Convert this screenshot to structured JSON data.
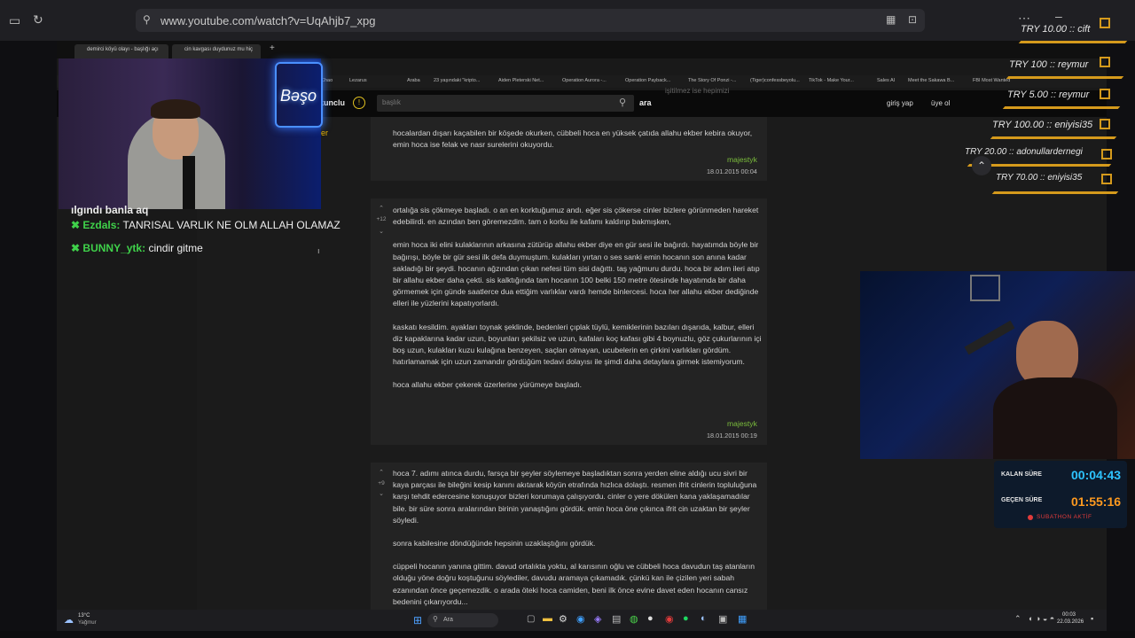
{
  "browser": {
    "url": "www.youtube.com/watch?v=UqAhjb7_xpg"
  },
  "inner_browser": {
    "tabs": [
      "demirci köyü olayı - başlığı açı",
      "cin kavgası duydunuz mu hiç"
    ],
    "bookmarks": [
      "Chao",
      "Lezarus",
      "Araba",
      "23 yaşındaki \"kripto...",
      "Aiden Pleterski Net...",
      "Operation Aurora -...",
      "Operation Payback...",
      "The Story Of Ponzi -...",
      "(Tiger)confessbeyolu...",
      "TikTok - Make Your...",
      "Sales AI",
      "Meet the Sakawa B...",
      "FBI Most Wanted"
    ]
  },
  "site": {
    "logo_fragment": "kunclu",
    "search_placeholder": "başlık",
    "search_button": "ara",
    "login": "giriş yap",
    "register": "üye ol",
    "side_fragment": "er",
    "top_banner": "işitilmez ise hepimizi"
  },
  "entries": [
    {
      "paragraphs": [
        "hocalardan dışarı kaçabilen bir köşede okurken, cübbeli hoca en yüksek çatıda allahu ekber kebira okuyor, emin hoca ise felak ve nasr surelerini okuyordu."
      ],
      "author": "majestyk",
      "date": "18.01.2015 00:04"
    },
    {
      "votes": "+12",
      "paragraphs": [
        "ortalığa sis çökmeye başladı. o an en korktuğumuz andı. eğer sis çökerse cinler bizlere görünmeden hareket edebilirdi. en azından ben göremezdim. tam o korku ile kafamı kaldırıp bakmışken,",
        "emin hoca iki elini kulaklarının arkasına zütürüp allahu ekber diye en gür sesi ile bağırdı. hayatımda böyle bir bağırışı, böyle bir gür sesi ilk defa duymuştum. kulakları yırtan o ses sanki emin hocanın son anına kadar sakladığı bir şeydi. hocanın ağzından çıkan nefesi tüm sisi dağıttı. taş yağmuru durdu. hoca bir adım ileri atıp bir allahu ekber daha çekti. sis kalktığında tam hocanın 100 belki 150 metre ötesinde hayatımda bir daha görmemek için günde saatlerce dua ettiğim varlıklar vardı hemde binlercesi. hoca her allahu ekber dediğinde elleri ile yüzlerini kapatıyorlardı.",
        "kaskatı kesildim. ayakları toynak şeklinde, bedenleri çıplak tüylü, kemiklerinin bazıları dışarıda, kalbur, elleri diz kapaklarına kadar uzun, boyunları şekilsiz ve uzun, kafaları koç kafası gibi 4 boynuzlu, göz çukurlarının içi boş uzun, kulakları kuzu kulağına benzeyen, saçları olmayan, ucubelerin en çirkini varlıkları gördüm. hatırlamamak için uzun zamandır gördüğüm tedavi dolayısı ile şimdi daha detaylara girmek istemiyorum.",
        "hoca allahu ekber çekerek üzerlerine yürümeye başladı."
      ],
      "author": "majestyk",
      "date": "18.01.2015 00:19"
    },
    {
      "votes": "+9",
      "paragraphs": [
        "hoca 7. adımı atınca durdu, farsça bir şeyler söylemeye başladıktan sonra yerden eline aldığı ucu sivri bir kaya parçası ile bileğini kesip kanını akıtarak köyün etrafında hızlıca dolaştı. resmen ifrit cinlerin topluluğuna karşı tehdit edercesine konuşuyor bizleri korumaya çalışıyordu. cinler o yere dökülen kana yaklaşamadılar bile. bir süre sonra aralarından birinin yanaştığını gördük. emin hoca öne çıkınca ifrit cin uzaktan bir şeyler söyledi.",
        "sonra kabilesine döndüğünde hepsinin uzaklaştığını gördük.",
        "cüppeli hocanın yanına gittim. davud ortalıkta yoktu, al karısının oğlu ve cübbeli hoca davudun taş atanların olduğu yöne doğru koştuğunu söylediler, davudu aramaya çıkamadık. çünkü kan ile çizilen yeri sabah ezanından önce geçemezdik. o arada öteki hoca camiden, beni ilk önce evine davet eden hocanın cansız bedenini çıkarıyordu..."
      ]
    }
  ],
  "chat": [
    {
      "user": "",
      "text": "ılgındı banla aq"
    },
    {
      "user": "Ezdals:",
      "text": "TANRISAL VARLIK NE OLM ALLAH OLAMAZ"
    },
    {
      "user": "BUNNY_ytk:",
      "text": "cindir gitme"
    }
  ],
  "overlay_logo": "Bəşo",
  "donations": [
    {
      "text": "TRY 10.00 :: cift"
    },
    {
      "text": "TRY 100 :: reymur"
    },
    {
      "text": "TRY 5.00 :: reymur"
    },
    {
      "text": "TRY 100.00 :: eniyisi35"
    },
    {
      "text": "TRY 20.00 :: adonullardernegi"
    },
    {
      "text": "TRY 70.00 :: eniyisi35"
    }
  ],
  "timer": {
    "remaining_label": "KALAN SÜRE",
    "remaining_value": "00:04:43",
    "elapsed_label": "GEÇEN SÜRE",
    "elapsed_value": "01:55:16",
    "status": "SUBATHON AKTİF",
    "colors": {
      "remaining": "#2ec4ff",
      "elapsed": "#ff9a1f",
      "status": "#e23b3b"
    }
  },
  "taskbar": {
    "weather_temp": "13°C",
    "weather_desc": "Yağmur",
    "search": "Ara",
    "time": "00:03",
    "date": "22.03.2026"
  }
}
